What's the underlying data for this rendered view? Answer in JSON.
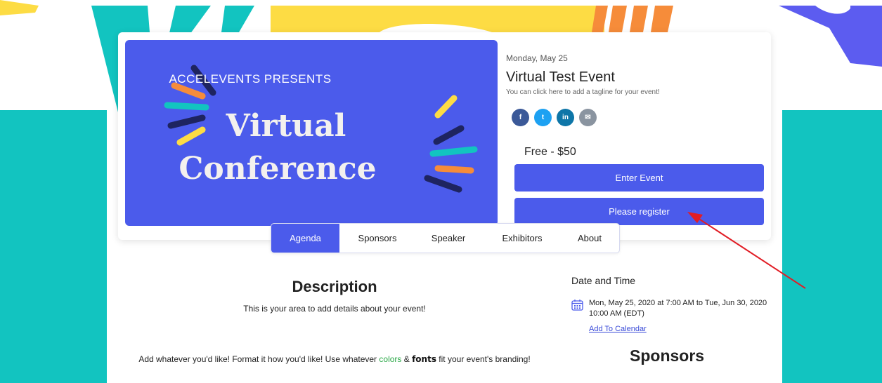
{
  "colors": {
    "accent": "#4b5beb",
    "teal": "#12c4c0",
    "yellow": "#fddc44",
    "orange": "#f68c3a",
    "arrow": "#e11d25",
    "link_green": "#28a745"
  },
  "banner": {
    "presents": "ACCELEVENTS PRESENTS",
    "line1": "Virtual",
    "line2": "Conference"
  },
  "event": {
    "date": "Monday, May 25",
    "title": "Virtual Test Event",
    "tagline": "You can click here to add a tagline for your event!",
    "price": "Free - $50",
    "enter_label": "Enter Event",
    "register_label": "Please register"
  },
  "social": [
    {
      "icon": "facebook-icon",
      "glyph": "f",
      "color": "#3b5998"
    },
    {
      "icon": "twitter-icon",
      "glyph": "t",
      "color": "#1da1f2"
    },
    {
      "icon": "linkedin-icon",
      "glyph": "in",
      "color": "#0e76a8"
    },
    {
      "icon": "email-icon",
      "glyph": "✉",
      "color": "#8a94a0"
    }
  ],
  "tabs": [
    {
      "label": "Agenda",
      "active": true
    },
    {
      "label": "Sponsors",
      "active": false
    },
    {
      "label": "Speaker",
      "active": false
    },
    {
      "label": "Exhibitors",
      "active": false
    },
    {
      "label": "About",
      "active": false
    }
  ],
  "description": {
    "heading": "Description",
    "text": "This is your area to add details about your event!",
    "brand_pre": "Add whatever you'd like! Format it how you'd like! Use whatever ",
    "brand_colors": "colors",
    "brand_amp": " & ",
    "brand_fonts": "fonts",
    "brand_post": " fit your event's branding!"
  },
  "date_time": {
    "heading": "Date and Time",
    "text": "Mon, May 25, 2020 at 7:00 AM to Tue, Jun 30, 2020 10:00 AM (EDT)",
    "add_calendar": "Add To Calendar"
  },
  "sponsors_heading": "Sponsors"
}
